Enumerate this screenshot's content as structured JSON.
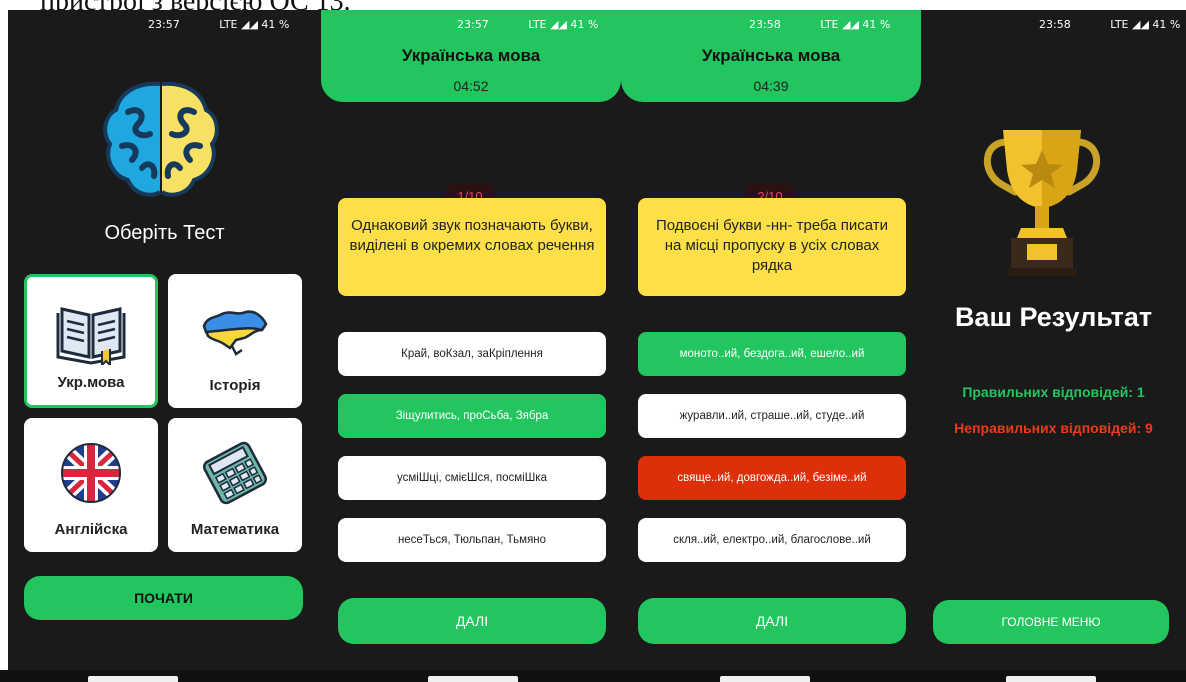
{
  "doc_fragment": "пристрої з версією ОС 13.",
  "colors": {
    "accent_green": "#22c55e",
    "question_yellow": "#fde047",
    "wrong_red": "#dc2f0a",
    "background": "#1a1a1a"
  },
  "screen1": {
    "status": {
      "time": "23:57",
      "network": "LTE ◢◢ 41 %"
    },
    "title": "Оберіть Тест",
    "tests": [
      {
        "label": "Укр.мова",
        "icon": "book-icon",
        "selected": true
      },
      {
        "label": "Історія",
        "icon": "ukraine-map-icon",
        "selected": false
      },
      {
        "label": "Англійска",
        "icon": "uk-flag-icon",
        "selected": false
      },
      {
        "label": "Математика",
        "icon": "calculator-icon",
        "selected": false
      }
    ],
    "start_button": "ПОЧАТИ"
  },
  "screen2": {
    "status": {
      "time": "23:57",
      "network": "LTE ◢◢ 41 %"
    },
    "subject": "Українська мова",
    "timer": "04:52",
    "counter": "1/10",
    "question": "Однаковий звук позначають букви, виділені в окремих словах речення",
    "answers": [
      {
        "text": "Край, воКзал, заКріплення",
        "state": "default"
      },
      {
        "text": "Зіщулитись, проСьба, Зябра",
        "state": "correct"
      },
      {
        "text": "усміШці, смієШся, посміШка",
        "state": "default"
      },
      {
        "text": "несеТься, Тюльпан, Тьмяно",
        "state": "default"
      }
    ],
    "next_button": "ДАЛІ"
  },
  "screen3": {
    "status": {
      "time": "23:58",
      "network": "LTE ◢◢ 41 %"
    },
    "subject": "Українська мова",
    "timer": "04:39",
    "counter": "2/10",
    "question": "Подвоєні букви -нн- треба писати на місці пропуску в усіх словах рядка",
    "answers": [
      {
        "text": "моното..ий, бездога..ий, ешело..ий",
        "state": "correct"
      },
      {
        "text": "журавли..ий, страше..ий, студе..ий",
        "state": "default"
      },
      {
        "text": "свяще..ий, довгожда..ий, безіме..ий",
        "state": "wrong"
      },
      {
        "text": "скля..ий, електро..ий, благослове..ий",
        "state": "default"
      }
    ],
    "next_button": "ДАЛІ"
  },
  "screen4": {
    "status": {
      "time": "23:58",
      "network": "LTE ◢◢ 41 %"
    },
    "result_title": "Ваш Результат",
    "correct_label": "Правильних відповідей: 1",
    "wrong_label": "Неправильних відповідей: 9",
    "menu_button": "ГОЛОВНЕ МЕНЮ"
  }
}
